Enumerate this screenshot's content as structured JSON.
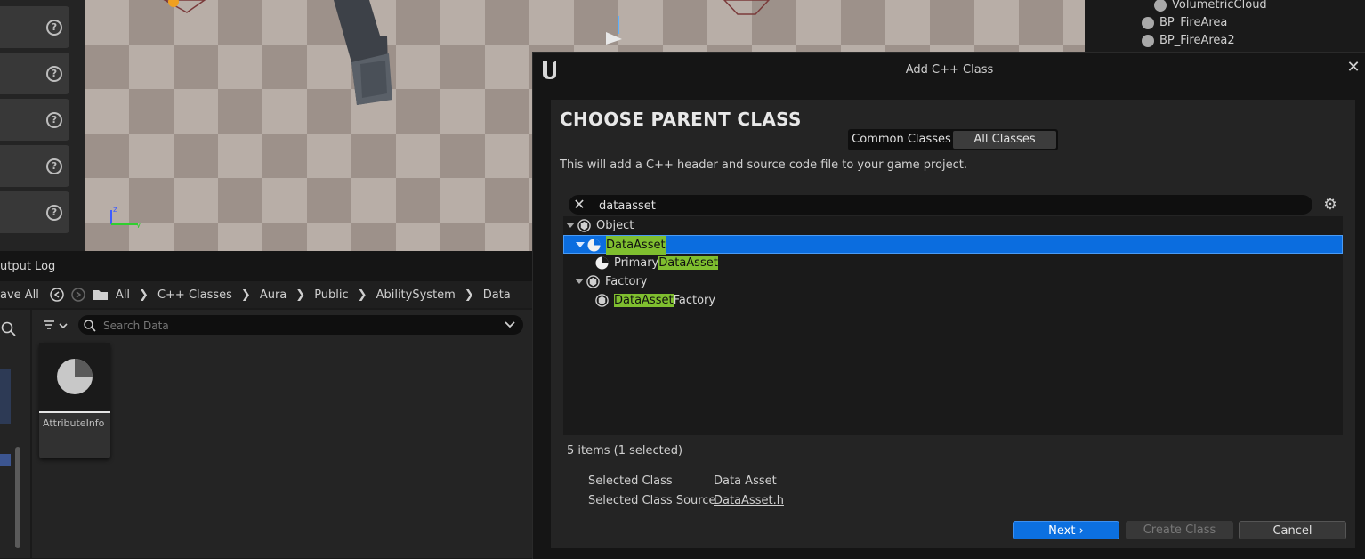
{
  "left_strip": {
    "help_count": 5
  },
  "outliner": {
    "items": [
      {
        "label": "VolumetricCloud"
      },
      {
        "label": "BP_FireArea"
      },
      {
        "label": "BP_FireArea2"
      }
    ]
  },
  "output_log": {
    "tab_label": "utput Log"
  },
  "content_browser": {
    "save_all_label": "ave All",
    "breadcrumb": [
      "All",
      "C++ Classes",
      "Aura",
      "Public",
      "AbilitySystem",
      "Data"
    ],
    "search_placeholder": "Search Data",
    "assets": [
      {
        "label": "AttributeInfo"
      }
    ]
  },
  "dialog": {
    "title": "Add C++ Class",
    "heading": "CHOOSE PARENT CLASS",
    "tabs": {
      "common": "Common Classes",
      "all": "All Classes",
      "active": "all"
    },
    "description": "This will add a C++ header and source code file to your game project.",
    "search_value": "dataasset",
    "tree": {
      "object": {
        "label": "Object"
      },
      "data_asset": {
        "match": "DataAsset",
        "selected": true
      },
      "primary": {
        "pre": "Primary",
        "match": "DataAsset"
      },
      "factory": {
        "label": "Factory"
      },
      "factory_child": {
        "match": "DataAsset",
        "post": "Factory"
      }
    },
    "count_text": "5 items (1 selected)",
    "selected_class_label": "Selected Class",
    "selected_class_value": "Data Asset",
    "selected_source_label": "Selected Class Source",
    "selected_source_value": "DataAsset.h",
    "buttons": {
      "next": "Next",
      "create": "Create Class",
      "cancel": "Cancel"
    },
    "colors": {
      "selection": "#0b6ddf",
      "match_highlight": "#7fbf2f",
      "primary_button": "#0c70e0"
    }
  }
}
